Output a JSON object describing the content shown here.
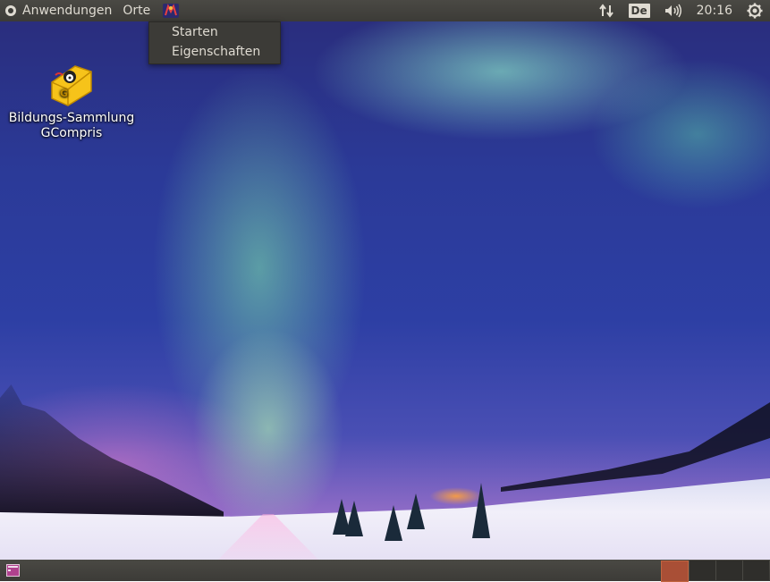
{
  "top_panel": {
    "menu_applications": "Anwendungen",
    "menu_places": "Orte",
    "launcher_icon": "gcompris-launcher-icon",
    "network_icon": "network-arrows-icon",
    "keyboard_layout": "De",
    "volume_icon": "speaker-volume-icon",
    "clock": "20:16",
    "session_icon": "power-gear-icon"
  },
  "context_menu": {
    "items": [
      {
        "label": "Starten"
      },
      {
        "label": "Eigenschaften"
      }
    ]
  },
  "desktop": {
    "icons": [
      {
        "label_line1": "Bildungs-Sammlung",
        "label_line2": "GCompris",
        "icon": "gcompris-icon"
      }
    ]
  },
  "bottom_panel": {
    "show_desktop_icon": "show-desktop-icon",
    "workspaces": [
      {
        "active": true
      },
      {
        "active": false
      },
      {
        "active": false
      },
      {
        "active": false
      }
    ]
  },
  "colors": {
    "panel": "#3c3b37",
    "panel_text": "#dfdbd2",
    "active_workspace": "#a94f36"
  }
}
